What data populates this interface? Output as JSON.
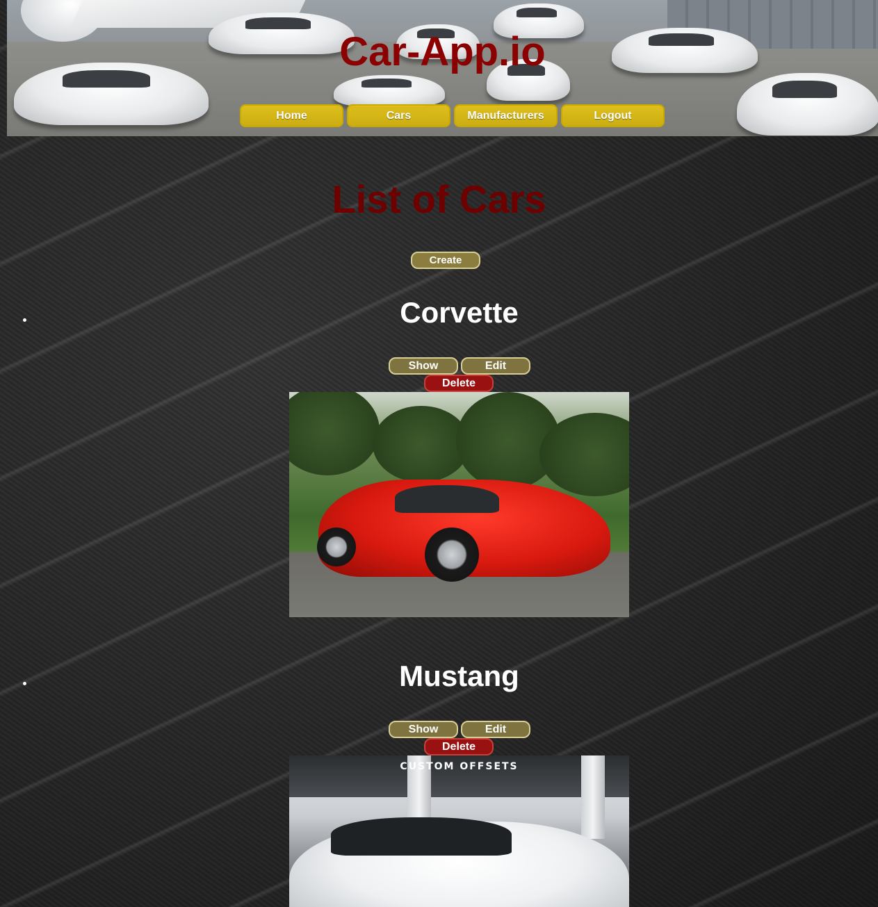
{
  "header": {
    "site_title": "Car-App.io",
    "nav": [
      {
        "label": "Home"
      },
      {
        "label": "Cars"
      },
      {
        "label": "Manufacturers"
      },
      {
        "label": "Logout"
      }
    ],
    "nav_color": "#e0bd14",
    "title_color": "#8b0000"
  },
  "main": {
    "page_title": "List of Cars",
    "create_label": "Create",
    "cars": [
      {
        "name": "Corvette",
        "show_label": "Show",
        "edit_label": "Edit",
        "delete_label": "Delete",
        "image_alt": "red-corvette-photo"
      },
      {
        "name": "Mustang",
        "show_label": "Show",
        "edit_label": "Edit",
        "delete_label": "Delete",
        "image_alt": "white-mustang-photo",
        "image_logo_text": "CUSTOM OFFSETS"
      }
    ]
  },
  "colors": {
    "button_olive": "#7f7440",
    "button_delete": "#9a1111",
    "heading_red": "#6e0000"
  }
}
